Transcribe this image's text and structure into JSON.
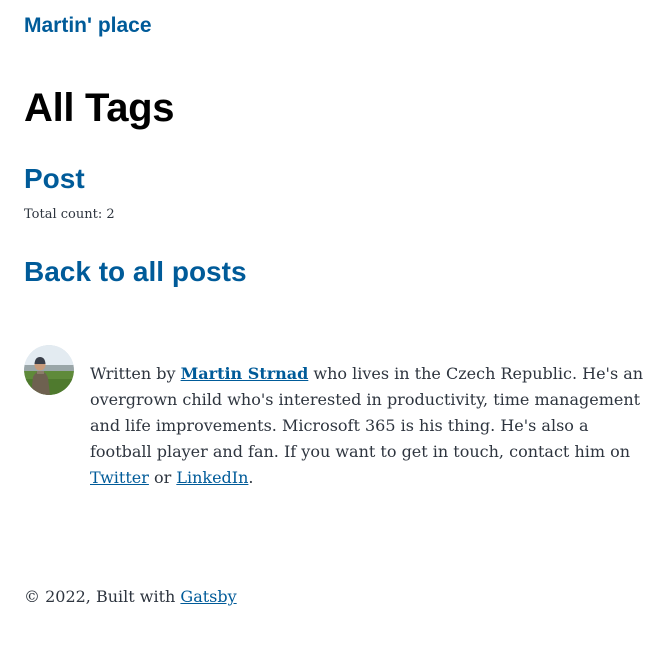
{
  "header": {
    "site_title": "Martin' place"
  },
  "main": {
    "heading": "All Tags",
    "tag": {
      "name": "Post",
      "count_text": "Total count: 2"
    },
    "back_link": "Back to all posts"
  },
  "bio": {
    "avatar_icon": "author-photo-icon",
    "prefix": "Written by ",
    "author_link": "Martin Strnad",
    "middle": " who lives in the Czech Republic. He's an overgrown child who's interested in productivity, time management and life improvements. Microsoft 365 is his thing. He's also a football player and fan. If you want to get in touch, contact him on ",
    "twitter_link": "Twitter",
    "or_text": " or ",
    "linkedin_link": "LinkedIn",
    "suffix": "."
  },
  "footer": {
    "prefix": "© 2022, Built with ",
    "gatsby_link": "Gatsby"
  },
  "colors": {
    "link": "#005b99",
    "text": "#2e353f",
    "heading": "#000000"
  }
}
